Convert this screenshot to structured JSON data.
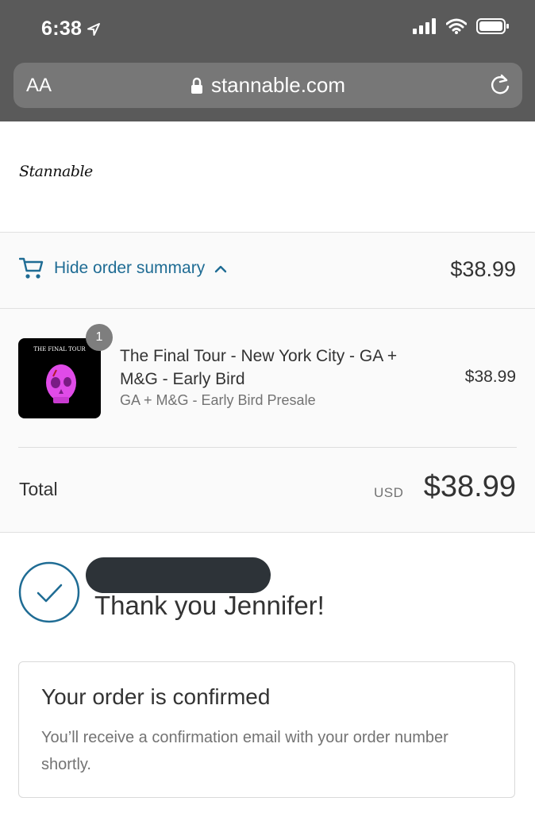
{
  "status_bar": {
    "time": "6:38"
  },
  "browser": {
    "text_size_label": "AA",
    "url": "stannable.com"
  },
  "store": {
    "logo_text": "Stannable"
  },
  "summary_toggle": {
    "label": "Hide order summary",
    "price": "$38.99"
  },
  "order": {
    "item": {
      "quantity": "1",
      "thumbnail_caption": "THE FINAL TOUR",
      "name": "The Final Tour - New York City - GA + M&G - Early Bird",
      "variant": "GA + M&G - Early Bird Presale",
      "price": "$38.99"
    },
    "total_label": "Total",
    "currency": "USD",
    "total_amount": "$38.99"
  },
  "confirmation": {
    "thank_you": "Thank you Jennifer!",
    "box_title": "Your order is confirmed",
    "box_text": "You’ll receive a confirmation email with your order number shortly."
  },
  "colors": {
    "accent": "#1f6c94",
    "chrome": "#5a5a5a",
    "url_bar": "#777777"
  }
}
